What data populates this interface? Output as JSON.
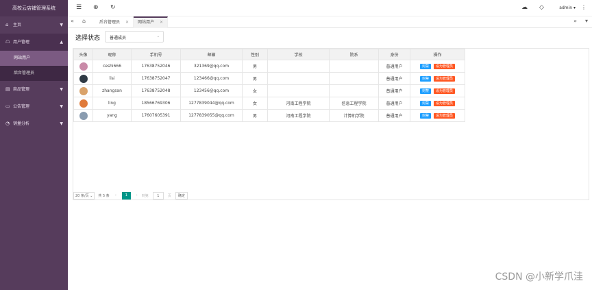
{
  "sidebar": {
    "title": "高校云店铺管理系统",
    "items": [
      {
        "label": "主页",
        "icon": "home-icon"
      },
      {
        "label": "用户管理",
        "icon": "user-icon",
        "children": [
          "网站用户",
          "后台管理员"
        ]
      },
      {
        "label": "商品管理",
        "icon": "goods-icon"
      },
      {
        "label": "公告管理",
        "icon": "notice-icon"
      },
      {
        "label": "销量分析",
        "icon": "chart-icon"
      }
    ]
  },
  "topbar": {
    "icons": [
      "menu-icon",
      "globe-icon",
      "refresh-icon",
      "theme-icon",
      "tag-icon",
      "more-icon"
    ],
    "user": "admin"
  },
  "tabs": [
    "后台管理员",
    "网站用户"
  ],
  "filter": {
    "label": "选择状态",
    "value": "普通成员"
  },
  "table": {
    "headers": [
      "头像",
      "昵称",
      "手机号",
      "邮箱",
      "性别",
      "学校",
      "院系",
      "身份",
      "操作"
    ],
    "rows": [
      {
        "name": "ceshi666",
        "phone": "17638752046",
        "email": "321369@qq.com",
        "gender": "男",
        "school": "",
        "dept": "",
        "role": "普通用户",
        "avatar": "#c98aa8"
      },
      {
        "name": "lisi",
        "phone": "17638752047",
        "email": "123466@qq.com",
        "gender": "男",
        "school": "",
        "dept": "",
        "role": "普通用户",
        "avatar": "#2f3a44"
      },
      {
        "name": "zhangsan",
        "phone": "17638752048",
        "email": "123456@qq.com",
        "gender": "女",
        "school": "",
        "dept": "",
        "role": "普通用户",
        "avatar": "#d9a26a"
      },
      {
        "name": "ling",
        "phone": "18566769306",
        "email": "1277839044@qq.com",
        "gender": "女",
        "school": "河南工程学院",
        "dept": "信息工程学院",
        "role": "普通用户",
        "avatar": "#e07a3a"
      },
      {
        "name": "yang",
        "phone": "17607605391",
        "email": "1277839055@qq.com",
        "gender": "男",
        "school": "河南工程学院",
        "dept": "计算机学院",
        "role": "普通用户",
        "avatar": "#8a9cb0"
      }
    ],
    "btn_block": "封禁",
    "btn_admin": "设为管理员"
  },
  "pager": {
    "size": "20 条/页",
    "total": "共 5 条",
    "current": "1",
    "goto_label": "到第",
    "goto_value": "1",
    "page_unit": "页",
    "confirm": "确定"
  },
  "watermark": "CSDN @小新学爪洼"
}
